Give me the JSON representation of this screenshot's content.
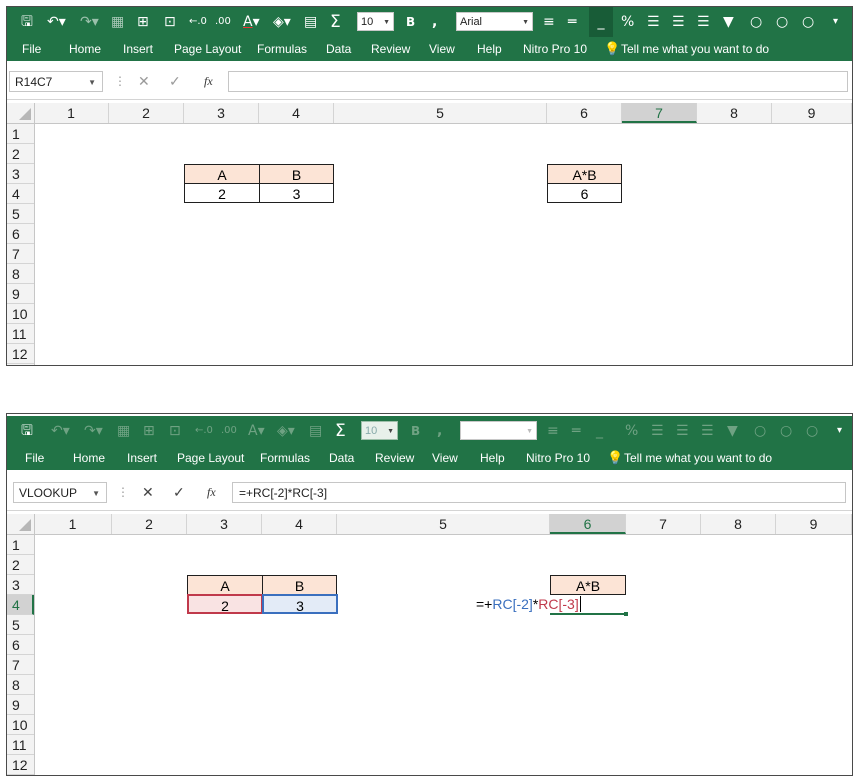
{
  "ribbon": {
    "font_size": "10",
    "font_name": "Arial",
    "tabs": [
      "File",
      "Home",
      "Insert",
      "Page Layout",
      "Formulas",
      "Data",
      "Review",
      "View",
      "Help",
      "Nitro Pro 10",
      "Tell me what you want to do"
    ],
    "accent_color": "#217346",
    "icons": [
      "save-icon",
      "undo-icon",
      "redo-icon",
      "borders-icon",
      "grid-icon",
      "cells-icon",
      "increase-decimal-icon",
      "decrease-decimal-icon",
      "font-color-icon",
      "fill-color-icon",
      "format-icon",
      "autosum-icon",
      "bold-icon",
      "comma-icon",
      "align-top-icon",
      "align-middle-icon",
      "align-bottom-icon",
      "percent-icon",
      "align-left-icon",
      "align-center-icon",
      "align-right-icon",
      "filter-icon",
      "circle-icon",
      "customize-icon",
      "lightbulb-icon"
    ]
  },
  "top": {
    "namebox": "R14C7",
    "formula": "",
    "columns": [
      "1",
      "2",
      "3",
      "4",
      "5",
      "6",
      "7",
      "8",
      "9"
    ],
    "rows": [
      "1",
      "2",
      "3",
      "4",
      "5",
      "6",
      "7",
      "8",
      "9",
      "10",
      "11",
      "12"
    ],
    "selected_column": "7",
    "cells": {
      "a_header": "A",
      "b_header": "B",
      "a_value": "2",
      "b_value": "3",
      "ab_header": "A*B",
      "ab_value": "6"
    }
  },
  "bottom": {
    "namebox": "VLOOKUP",
    "formula": "=+RC[-2]*RC[-3]",
    "columns": [
      "1",
      "2",
      "3",
      "4",
      "5",
      "6",
      "7",
      "8",
      "9"
    ],
    "rows": [
      "1",
      "2",
      "3",
      "4",
      "5",
      "6",
      "7",
      "8",
      "9",
      "10",
      "11",
      "12"
    ],
    "selected_column": "6",
    "selected_row": "4",
    "cells": {
      "a_header": "A",
      "b_header": "B",
      "a_value": "2",
      "b_value": "3",
      "ab_header": "A*B"
    },
    "inline_formula": {
      "prefix": "=+",
      "ref1": "RC[-2]",
      "op": "*",
      "ref2": "RC[-3]"
    },
    "ref_colors": {
      "ref1": "#3a6fbe",
      "ref2": "#c0394b"
    }
  }
}
